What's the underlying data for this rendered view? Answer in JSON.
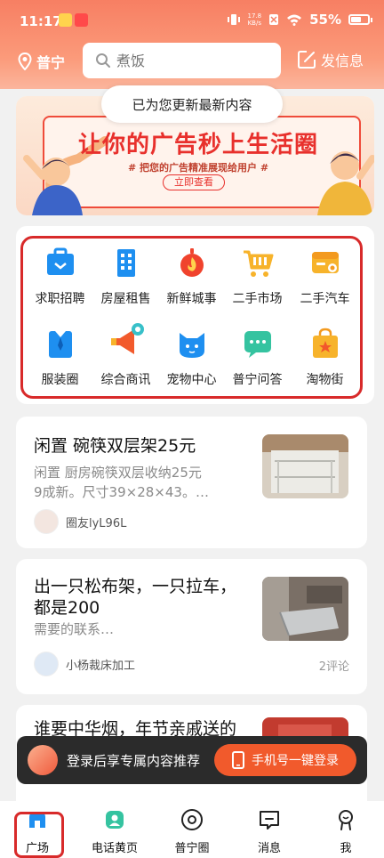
{
  "status_bar": {
    "time": "11:17",
    "net_speed_value": "17.8",
    "net_speed_unit": "KB/s",
    "battery": "55%"
  },
  "header": {
    "location": "普宁",
    "search_placeholder": "煮饭",
    "post_label": "发信息"
  },
  "toast": "已为您更新最新内容",
  "banner": {
    "title": "让你的广告秒上生活圈",
    "subtitle": "# 把您的广告精准展现给用户 #",
    "cta": "立即查看"
  },
  "categories": [
    {
      "label": "求职招聘",
      "icon": "briefcase-icon"
    },
    {
      "label": "房屋租售",
      "icon": "building-icon"
    },
    {
      "label": "新鲜城事",
      "icon": "flame-icon"
    },
    {
      "label": "二手市场",
      "icon": "shopping-cart-icon"
    },
    {
      "label": "二手汽车",
      "icon": "car-icon"
    },
    {
      "label": "服装圈",
      "icon": "shirt-icon"
    },
    {
      "label": "综合商讯",
      "icon": "megaphone-icon"
    },
    {
      "label": "宠物中心",
      "icon": "cat-icon"
    },
    {
      "label": "普宁问答",
      "icon": "chat-bubble-icon"
    },
    {
      "label": "淘物街",
      "icon": "shopping-bag-icon"
    }
  ],
  "feed": [
    {
      "title": "闲置 碗筷双层架25元",
      "desc_line1": "闲置 厨房碗筷双层收纳25元",
      "desc_line2": "9成新。尺寸39×28×43。…",
      "user": "圈友lyL96L",
      "comments": ""
    },
    {
      "title_line1": "出一只松布架，一只拉车，",
      "title_line2": "都是200",
      "desc_line1": "需要的联系…",
      "user": "小杨裁床加工",
      "comments": "2评论"
    },
    {
      "title": "谁要中华烟，年节亲戚送的"
    }
  ],
  "login_banner": {
    "text": "登录后享专属内容推荐",
    "button": "手机号一键登录"
  },
  "tabs": [
    {
      "label": "广场",
      "icon": "home-icon"
    },
    {
      "label": "电话黄页",
      "icon": "contact-book-icon"
    },
    {
      "label": "普宁圈",
      "icon": "circle-icon"
    },
    {
      "label": "消息",
      "icon": "message-icon"
    },
    {
      "label": "我",
      "icon": "profile-icon"
    }
  ],
  "colors": {
    "brand": "#f77f63",
    "accent": "#f15a2c",
    "highlight_outline": "#d82a2a"
  }
}
